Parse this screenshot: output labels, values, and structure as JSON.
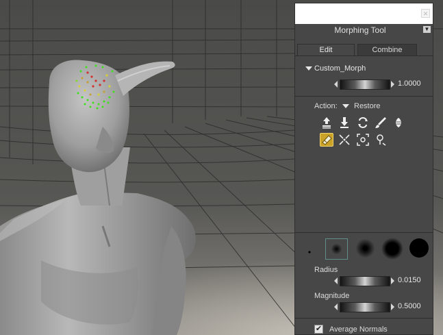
{
  "panel": {
    "title": "Morphing Tool",
    "tabs": [
      {
        "label": "Edit",
        "active": true
      },
      {
        "label": "Combine",
        "active": false
      }
    ],
    "morph": {
      "name": "Custom_Morph",
      "value": "1.0000"
    },
    "action": {
      "label": "Action:",
      "selected": "Restore"
    },
    "tools": [
      {
        "icon": "push-icon"
      },
      {
        "icon": "pull-icon"
      },
      {
        "icon": "smooth-icon"
      },
      {
        "icon": "sculpt-brush-icon"
      },
      {
        "icon": "inflate-icon"
      },
      {
        "icon": "restore-eraser-icon",
        "selected": true
      },
      {
        "icon": "pinch-icon"
      },
      {
        "icon": "flatten-icon"
      },
      {
        "icon": "pin-icon"
      }
    ],
    "brushes": [
      {
        "name": "brush-preset-tiny"
      },
      {
        "name": "brush-preset-small",
        "selected": true
      },
      {
        "name": "brush-preset-medium"
      },
      {
        "name": "brush-preset-large"
      },
      {
        "name": "brush-preset-hard"
      }
    ],
    "radius": {
      "label": "Radius",
      "value": "0.0150"
    },
    "magnitude": {
      "label": "Magnitude",
      "value": "0.5000"
    },
    "average_normals": {
      "label": "Average Normals",
      "checked": true
    }
  },
  "colors": {
    "panel_bg": "#474747",
    "selected_tool": "#c9a227",
    "morph_dots_green": "#3fe21a",
    "morph_dots_red": "#d2322d"
  }
}
